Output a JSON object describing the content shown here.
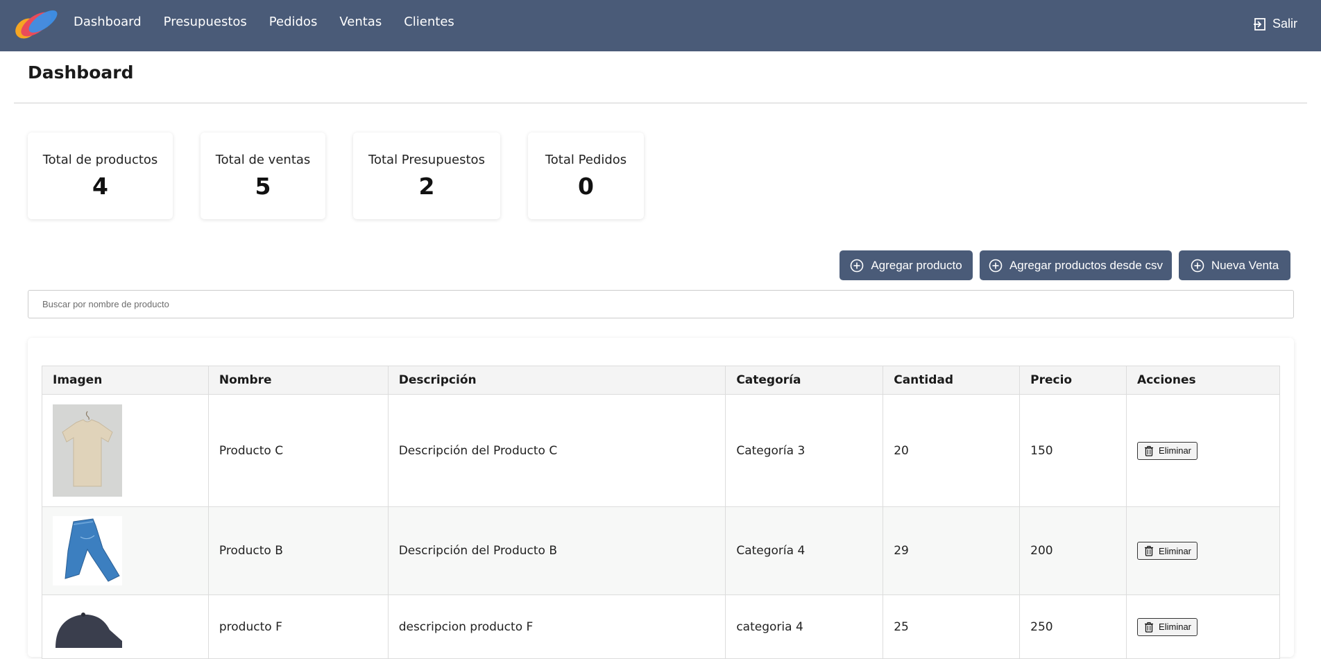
{
  "nav": {
    "items": [
      {
        "label": "Dashboard"
      },
      {
        "label": "Presupuestos"
      },
      {
        "label": "Pedidos"
      },
      {
        "label": "Ventas"
      },
      {
        "label": "Clientes"
      }
    ],
    "logout_label": "Salir"
  },
  "page": {
    "title": "Dashboard"
  },
  "stats": [
    {
      "label": "Total de productos",
      "value": "4"
    },
    {
      "label": "Total de ventas",
      "value": "5"
    },
    {
      "label": "Total Presupuestos",
      "value": "2"
    },
    {
      "label": "Total Pedidos",
      "value": "0"
    }
  ],
  "actions": {
    "add_product": "Agregar producto",
    "add_csv": "Agregar productos desde csv",
    "new_sale": "Nueva Venta"
  },
  "search": {
    "placeholder": "Buscar por nombre de producto"
  },
  "table": {
    "headers": [
      "Imagen",
      "Nombre",
      "Descripción",
      "Categoría",
      "Cantidad",
      "Precio",
      "Acciones"
    ],
    "rows": [
      {
        "image": "tshirt-image",
        "name": "Producto C",
        "description": "Descripción del Producto C",
        "category": "Categoría 3",
        "quantity": "20",
        "price": "150",
        "action": "Eliminar"
      },
      {
        "image": "jeans-image",
        "name": "Producto B",
        "description": "Descripción del Producto B",
        "category": "Categoría 4",
        "quantity": "29",
        "price": "200",
        "action": "Eliminar"
      },
      {
        "image": "cap-image",
        "name": "producto F",
        "description": "descripcion producto F",
        "category": "categoria 4",
        "quantity": "25",
        "price": "250",
        "action": "Eliminar"
      }
    ]
  },
  "colors": {
    "navbar": "#4a5b78",
    "button": "#4a5b78"
  }
}
